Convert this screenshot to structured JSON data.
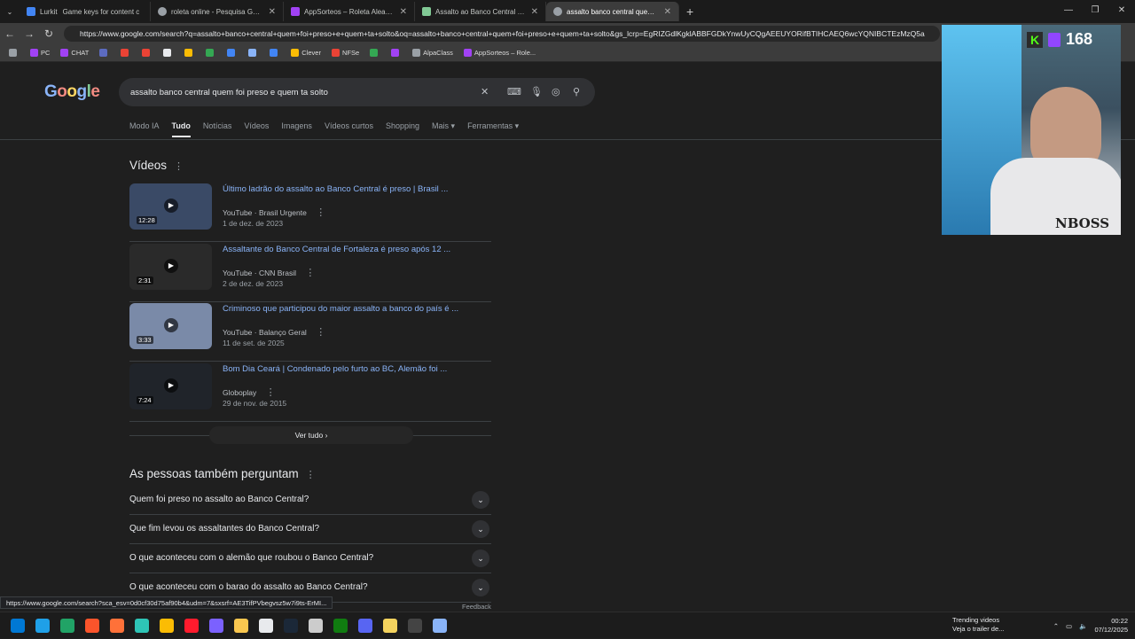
{
  "browser": {
    "tabs": [
      {
        "title": "Lurkit",
        "color": "#4285f4"
      },
      {
        "title": "Game keys for content c",
        "color": "#1a73e8"
      },
      {
        "title": "roleta online - Pesquisa Google",
        "color": "#9aa0a6"
      },
      {
        "title": "AppSorteos – Roleta Aleatoria",
        "color": "#a142f4"
      },
      {
        "title": "Assalto ao Banco Central filme - C",
        "color": "#81c995"
      },
      {
        "title": "assalto banco central quem foi pr",
        "color": "#9aa0a6"
      }
    ],
    "url": "https://www.google.com/search?q=assalto+banco+central+quem+foi+preso+e+quem+ta+solto&oq=assalto+banco+central+quem+foi+preso+e+quem+ta+solto&gs_lcrp=EgRIZGdlKgklABBFGDkYnwUyCQgAEEUYORifBTIHCAEQ6wcYQNIBCTEzMzQ5a",
    "bookmarks": [
      {
        "label": "",
        "color": "#9aa0a6"
      },
      {
        "label": "PC",
        "color": "#a142f4"
      },
      {
        "label": "CHAT",
        "color": "#a142f4"
      },
      {
        "label": "",
        "color": "#5c6bc0"
      },
      {
        "label": "",
        "color": "#ea4335"
      },
      {
        "label": "",
        "color": "#ea4335"
      },
      {
        "label": "",
        "color": "#e8eaed"
      },
      {
        "label": "",
        "color": "#fbbc04"
      },
      {
        "label": "",
        "color": "#34a853"
      },
      {
        "label": "",
        "color": "#4285f4"
      },
      {
        "label": "",
        "color": "#8ab4f8"
      },
      {
        "label": "",
        "color": "#4285f4"
      },
      {
        "label": "Clever",
        "color": "#fbbc04"
      },
      {
        "label": "NFSe",
        "color": "#ea4335"
      },
      {
        "label": "",
        "color": "#34a853"
      },
      {
        "label": "",
        "color": "#a142f4"
      },
      {
        "label": "AlpaClass",
        "color": "#9aa0a6"
      },
      {
        "label": "AppSorteos – Role...",
        "color": "#a142f4"
      }
    ],
    "status_url": "https://www.google.com/search?sca_esv=0d0cf30d75af90b4&udm=7&sxsrf=AE3TifPVbegvsz5w7i9ts-ErMI..."
  },
  "google": {
    "query": "assalto banco central quem foi preso e quem ta solto",
    "nav": [
      "Modo IA",
      "Tudo",
      "Notícias",
      "Vídeos",
      "Imagens",
      "Vídeos curtos",
      "Shopping",
      "Mais",
      "Ferramentas"
    ],
    "videos_title": "Vídeos",
    "videos": [
      {
        "title": "Último ladrão do assalto ao Banco Central é preso | Brasil ...",
        "source": "YouTube · Brasil Urgente",
        "date": "1 de dez. de 2023",
        "duration": "12:28"
      },
      {
        "title": "Assaltante do Banco Central de Fortaleza é preso após 12 ...",
        "source": "YouTube · CNN Brasil",
        "date": "2 de dez. de 2023",
        "duration": "2:31"
      },
      {
        "title": "Criminoso que participou do maior assalto a banco do país é ...",
        "source": "YouTube · Balanço Geral",
        "date": "11 de set. de 2025",
        "duration": "3:33"
      },
      {
        "title": "Bom Dia Ceará | Condenado pelo furto ao BC, Alemão foi ...",
        "source": "Globoplay",
        "date": "29 de nov. de 2015",
        "duration": "7:24"
      }
    ],
    "ver_tudo": "Ver tudo",
    "paa_title": "As pessoas também perguntam",
    "questions": [
      "Quem foi preso no assalto ao Banco Central?",
      "Que fim levou os assaltantes do Banco Central?",
      "O que aconteceu com o alemão que roubou o Banco Central?",
      "O que aconteceu com o barao do assalto ao Banco Central?"
    ],
    "feedback": "Feedback"
  },
  "stream": {
    "viewers": "168",
    "shirt_logo": "NBOSS"
  },
  "taskbar": {
    "trending_title": "Trending videos",
    "trending_sub": "Veja o trailer de...",
    "time": "00:22",
    "date": "07/12/2025"
  }
}
